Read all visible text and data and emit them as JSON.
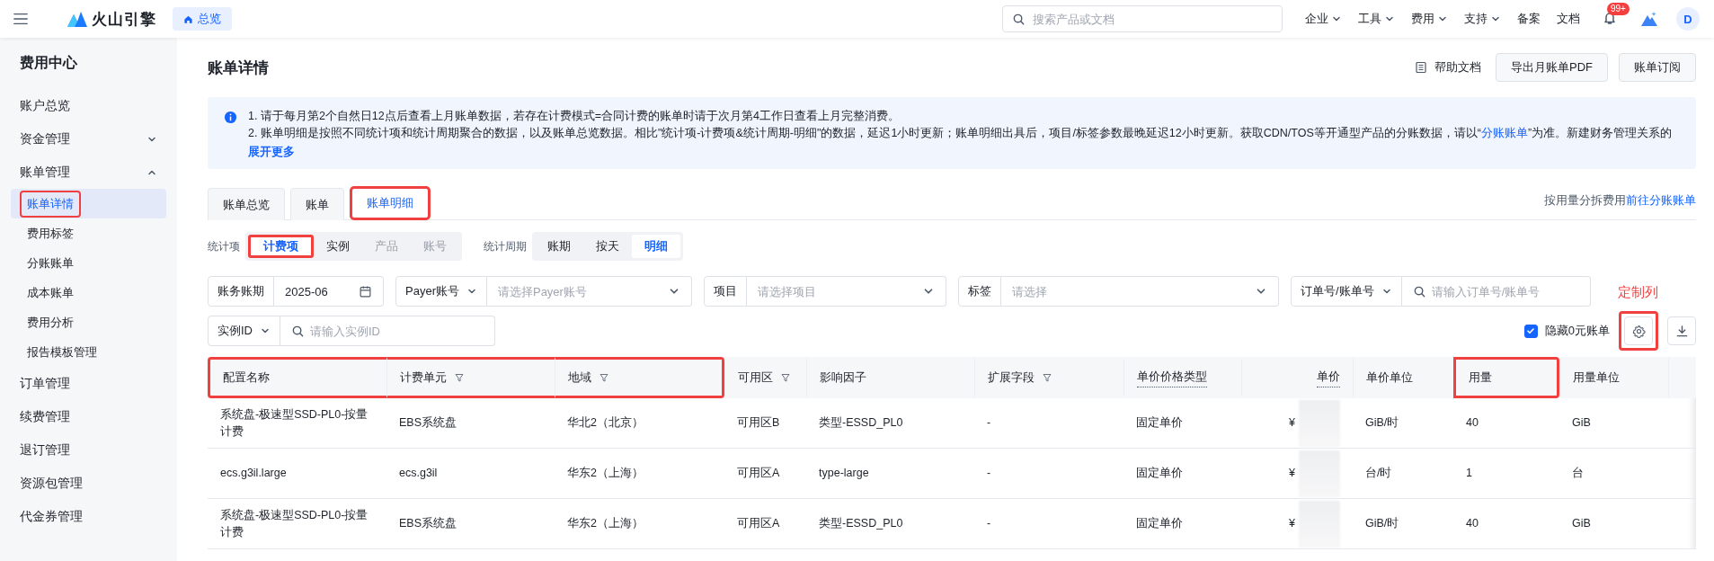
{
  "topbar": {
    "brand": "火山引擎",
    "home_tag": "总览",
    "search": {
      "placeholder": "搜索产品或文档"
    },
    "nav": [
      {
        "label": "企业",
        "dropdown": true
      },
      {
        "label": "工具",
        "dropdown": true
      },
      {
        "label": "费用",
        "dropdown": true
      },
      {
        "label": "支持",
        "dropdown": true
      },
      {
        "label": "备案",
        "dropdown": false
      },
      {
        "label": "文档",
        "dropdown": false
      }
    ],
    "notification_badge": "99+",
    "avatar": "D"
  },
  "sidebar": {
    "title": "费用中心",
    "items": [
      {
        "kind": "link",
        "label": "账户总览",
        "selected": false,
        "annotated": false
      },
      {
        "kind": "group",
        "label": "资金管理",
        "expanded": false,
        "selected": false,
        "annotated": false
      },
      {
        "kind": "group",
        "label": "账单管理",
        "expanded": true,
        "selected": false,
        "annotated": false,
        "children": [
          {
            "label": "账单详情",
            "selected": true,
            "annotated": true
          },
          {
            "label": "费用标签",
            "selected": false,
            "annotated": false
          },
          {
            "label": "分账账单",
            "selected": false,
            "annotated": false
          },
          {
            "label": "成本账单",
            "selected": false,
            "annotated": false
          },
          {
            "label": "费用分析",
            "selected": false,
            "annotated": false
          },
          {
            "label": "报告模板管理",
            "selected": false,
            "annotated": false
          }
        ]
      },
      {
        "kind": "link",
        "label": "订单管理",
        "selected": false,
        "annotated": false
      },
      {
        "kind": "link",
        "label": "续费管理",
        "selected": false,
        "annotated": false
      },
      {
        "kind": "link",
        "label": "退订管理",
        "selected": false,
        "annotated": false
      },
      {
        "kind": "link",
        "label": "资源包管理",
        "selected": false,
        "annotated": false
      },
      {
        "kind": "link",
        "label": "代金券管理",
        "selected": false,
        "annotated": false
      }
    ]
  },
  "page": {
    "title": "账单详情",
    "help_link": "帮助文档",
    "buttons": [
      "导出月账单PDF",
      "账单订阅"
    ]
  },
  "notice": {
    "line_1": "1. 请于每月第2个自然日12点后查看上月账单数据，若存在计费模式=合同计费的账单时请于次月第4工作日查看上月完整消费。",
    "line_2_before": "2. 账单明细是按照不同统计项和统计周期聚合的数据，以及账单总览数据。相比\"统计项-计费项&统计周期-明细\"的数据，延迟1小时更新；账单明细出具后，项目/标签参数最晚延迟12小时更新。获取CDN/TOS等开通型产品的分账数据，请以“",
    "line_2_link": "分账账单",
    "line_2_after": "”为准。新建财务管理关系的",
    "expand_link": "展开更多"
  },
  "tabs": [
    {
      "label": "账单总览",
      "selected": false,
      "annotated": false
    },
    {
      "label": "账单",
      "selected": false,
      "annotated": false
    },
    {
      "label": "账单明细",
      "selected": true,
      "annotated": true
    }
  ],
  "tabs_extra": {
    "text": "按用量分拆费用",
    "link": "前往分账账单"
  },
  "dimension": {
    "label": "统计项",
    "options": [
      {
        "label": "计费项",
        "selected": true,
        "disabled": false,
        "annotated": true
      },
      {
        "label": "实例",
        "selected": false,
        "disabled": false,
        "annotated": false
      },
      {
        "label": "产品",
        "selected": false,
        "disabled": true,
        "annotated": false
      },
      {
        "label": "账号",
        "selected": false,
        "disabled": true,
        "annotated": false
      }
    ]
  },
  "period": {
    "label": "统计周期",
    "options": [
      {
        "label": "账期",
        "selected": false
      },
      {
        "label": "按天",
        "selected": false
      },
      {
        "label": "明细",
        "selected": true
      }
    ]
  },
  "filters": [
    {
      "kind": "date",
      "label": "账务账期",
      "label_dropdown": false,
      "value": "2025-06"
    },
    {
      "kind": "select",
      "label": "Payer账号",
      "label_dropdown": true,
      "placeholder": "请选择Payer账号"
    },
    {
      "kind": "select",
      "label": "项目",
      "label_dropdown": false,
      "placeholder": "请选择项目"
    },
    {
      "kind": "select",
      "label": "标签",
      "label_dropdown": false,
      "placeholder": "请选择"
    },
    {
      "kind": "search",
      "label": "订单号/账单号",
      "label_dropdown": true,
      "placeholder": "请输入订单号/账单号"
    },
    {
      "kind": "search",
      "label": "实例ID",
      "label_dropdown": true,
      "placeholder": "请输入实例ID"
    }
  ],
  "toolbar": {
    "hide_zero": {
      "label": "隐藏0元账单",
      "checked": true
    },
    "annotation_label": "定制列",
    "settings_annotated": true
  },
  "table": {
    "columns": [
      {
        "label": "配置名称",
        "kind": "text",
        "filter": false,
        "hint": false,
        "annotated": true
      },
      {
        "label": "计费单元",
        "kind": "text",
        "filter": true,
        "hint": false,
        "annotated": true
      },
      {
        "label": "地域",
        "kind": "text",
        "filter": true,
        "hint": false,
        "annotated": true
      },
      {
        "label": "可用区",
        "kind": "text",
        "filter": true,
        "hint": false,
        "annotated": false
      },
      {
        "label": "影响因子",
        "kind": "text",
        "filter": false,
        "hint": false,
        "annotated": false
      },
      {
        "label": "扩展字段",
        "kind": "text",
        "filter": true,
        "hint": false,
        "annotated": false
      },
      {
        "label": "单价价格类型",
        "kind": "text",
        "filter": false,
        "hint": true,
        "annotated": false
      },
      {
        "label": "单价",
        "kind": "price",
        "filter": false,
        "hint": true,
        "annotated": false
      },
      {
        "label": "单价单位",
        "kind": "text",
        "filter": false,
        "hint": false,
        "annotated": false
      },
      {
        "label": "用量",
        "kind": "text",
        "filter": false,
        "hint": false,
        "annotated": true
      },
      {
        "label": "用量单位",
        "kind": "text",
        "filter": false,
        "hint": false,
        "annotated": false
      }
    ],
    "rows": [
      [
        "系统盘-极速型SSD-PL0-按量计费",
        "EBS系统盘",
        "华北2（北京）",
        "可用区B",
        "类型-ESSD_PL0",
        "-",
        "固定单价",
        "¥",
        "GiB/时",
        "40",
        "GiB"
      ],
      [
        "ecs.g3il.large",
        "ecs.g3il",
        "华东2（上海）",
        "可用区A",
        "type-large",
        "-",
        "固定单价",
        "¥",
        "台/时",
        "1",
        "台"
      ],
      [
        "系统盘-极速型SSD-PL0-按量计费",
        "EBS系统盘",
        "华东2（上海）",
        "可用区A",
        "类型-ESSD_PL0",
        "-",
        "固定单价",
        "¥",
        "GiB/时",
        "40",
        "GiB"
      ]
    ]
  }
}
